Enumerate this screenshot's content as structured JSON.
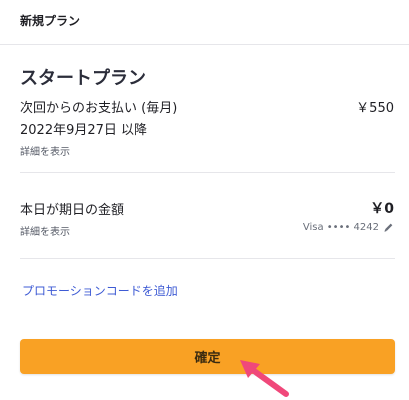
{
  "header": {
    "title": "新規プラン"
  },
  "plan": {
    "name": "スタートプラン",
    "billing_line1": "次回からのお支払い (毎月)",
    "billing_line2": "2022年9月27日 以降",
    "price": "￥550",
    "details_label": "詳細を表示"
  },
  "today": {
    "label": "本日が期日の金額",
    "amount": "￥0",
    "details_label": "詳細を表示",
    "card": "Visa •••• 4242",
    "edit_icon": "pencil-icon"
  },
  "promo": {
    "label": "プロモーションコードを追加"
  },
  "confirm": {
    "label": "確定"
  },
  "colors": {
    "accent": "#f9a124",
    "link": "#3e5bd4",
    "annotation_arrow": "#f0487a"
  },
  "annotation": {
    "icon": "pointer-arrow-icon"
  }
}
